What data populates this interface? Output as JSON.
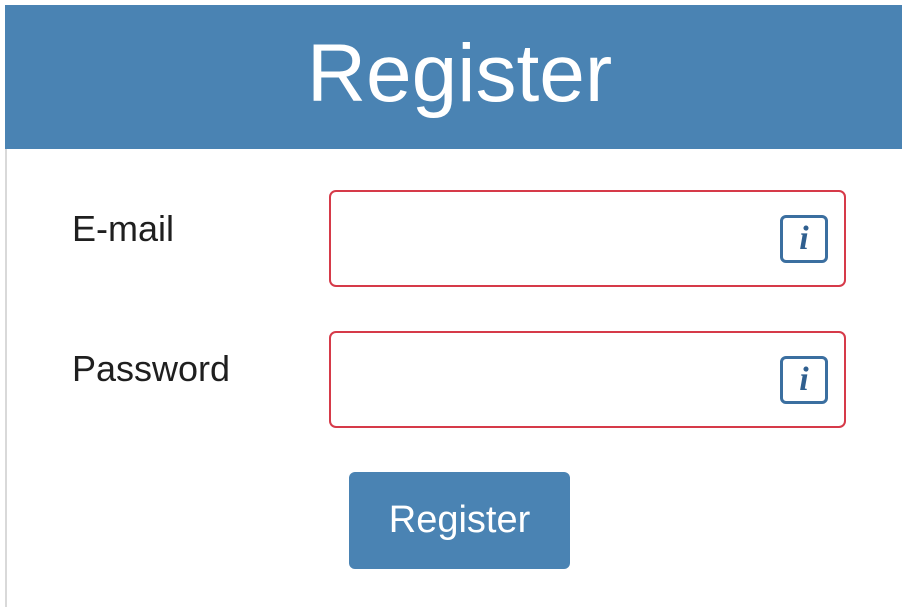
{
  "header": {
    "title": "Register"
  },
  "form": {
    "email": {
      "label": "E-mail",
      "value": "",
      "placeholder": "",
      "icon": "info-icon",
      "icon_glyph": "i"
    },
    "password": {
      "label": "Password",
      "value": "",
      "placeholder": "",
      "icon": "info-icon",
      "icon_glyph": "i"
    },
    "submit_label": "Register"
  },
  "colors": {
    "accent": "#4a83b3",
    "invalid_border": "#d63a49",
    "icon_border": "#3b6fa0"
  }
}
